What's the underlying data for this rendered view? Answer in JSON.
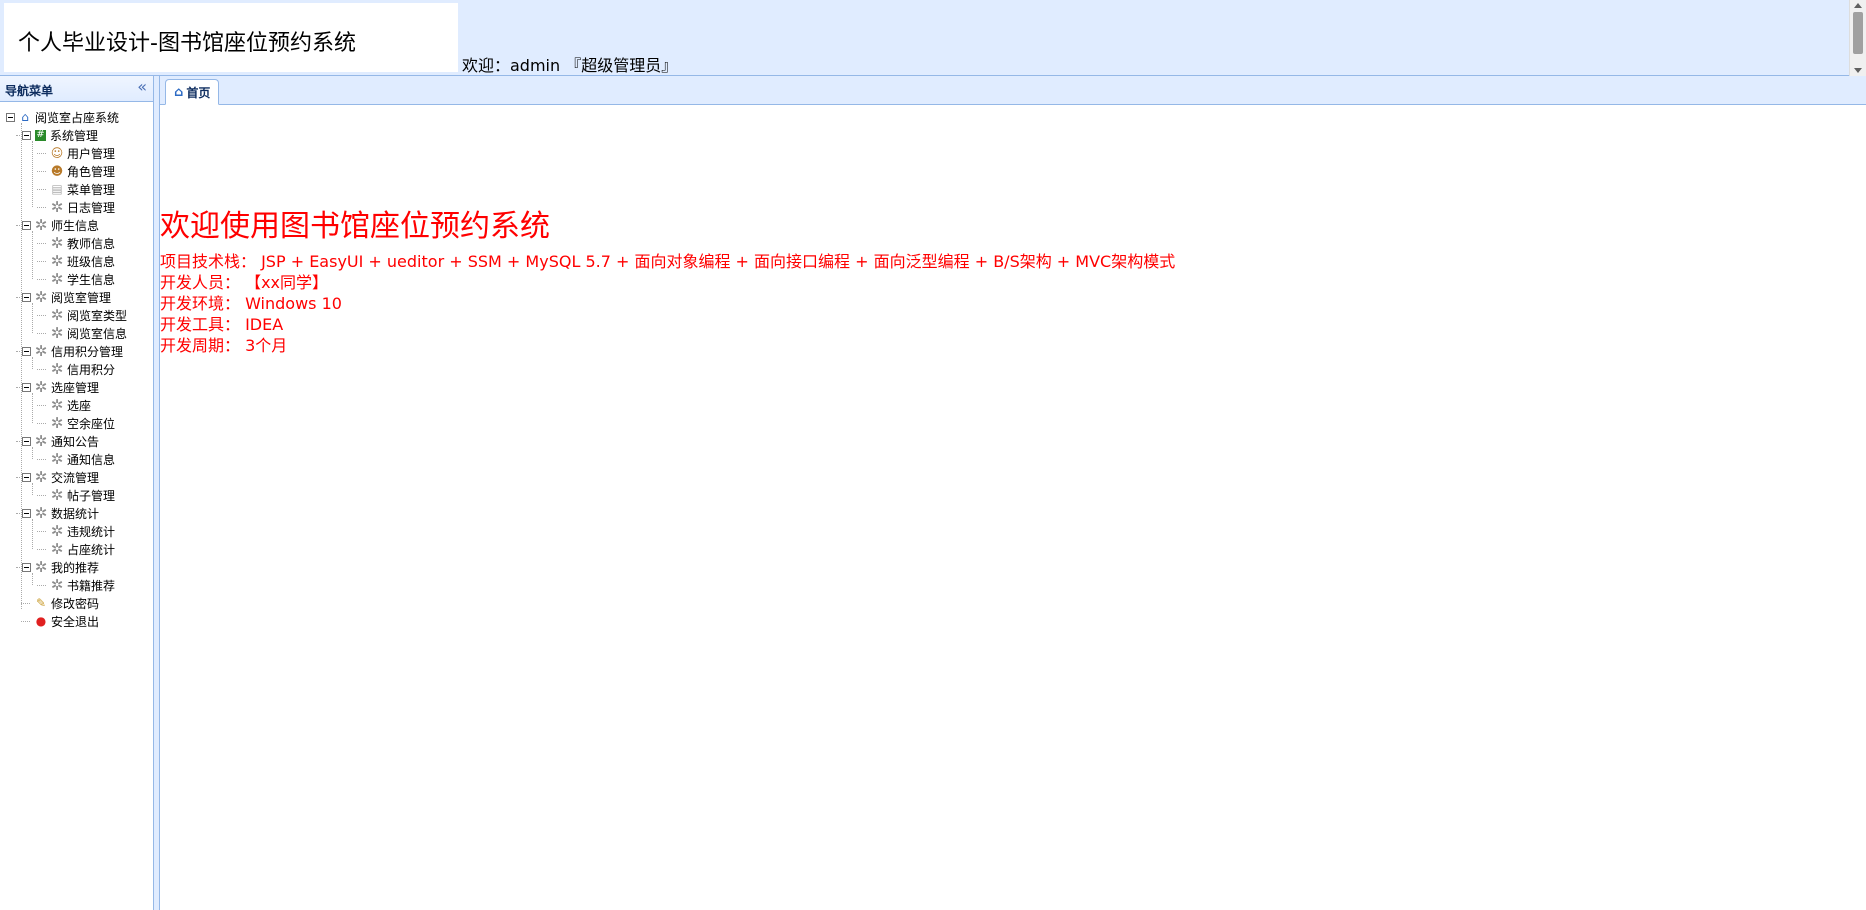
{
  "header": {
    "title": "个人毕业设计-图书馆座位预约系统",
    "welcome": "欢迎：admin 『超级管理员』"
  },
  "sidebar": {
    "title": "导航菜单",
    "collapse_icon": "double-chevron-left-icon",
    "root": {
      "label": "阅览室占座系统",
      "icon": "home-icon"
    },
    "groups": [
      {
        "label": "系统管理",
        "icon": "system-icon",
        "children": [
          {
            "label": "用户管理",
            "icon": "user-icon"
          },
          {
            "label": "角色管理",
            "icon": "role-icon"
          },
          {
            "label": "菜单管理",
            "icon": "menu-icon"
          },
          {
            "label": "日志管理",
            "icon": "gear-icon"
          }
        ]
      },
      {
        "label": "师生信息",
        "icon": "gear-icon",
        "children": [
          {
            "label": "教师信息",
            "icon": "gear-icon"
          },
          {
            "label": "班级信息",
            "icon": "gear-icon"
          },
          {
            "label": "学生信息",
            "icon": "gear-icon"
          }
        ]
      },
      {
        "label": "阅览室管理",
        "icon": "gear-icon",
        "children": [
          {
            "label": "阅览室类型",
            "icon": "gear-icon"
          },
          {
            "label": "阅览室信息",
            "icon": "gear-icon"
          }
        ]
      },
      {
        "label": "信用积分管理",
        "icon": "gear-icon",
        "children": [
          {
            "label": "信用积分",
            "icon": "gear-icon"
          }
        ]
      },
      {
        "label": "选座管理",
        "icon": "gear-icon",
        "children": [
          {
            "label": "选座",
            "icon": "gear-icon"
          },
          {
            "label": "空余座位",
            "icon": "gear-icon"
          }
        ]
      },
      {
        "label": "通知公告",
        "icon": "gear-icon",
        "children": [
          {
            "label": "通知信息",
            "icon": "gear-icon"
          }
        ]
      },
      {
        "label": "交流管理",
        "icon": "gear-icon",
        "children": [
          {
            "label": "帖子管理",
            "icon": "gear-icon"
          }
        ]
      },
      {
        "label": "数据统计",
        "icon": "gear-icon",
        "children": [
          {
            "label": "违规统计",
            "icon": "gear-icon"
          },
          {
            "label": "占座统计",
            "icon": "gear-icon"
          }
        ]
      },
      {
        "label": "我的推荐",
        "icon": "gear-icon",
        "children": [
          {
            "label": "书籍推荐",
            "icon": "gear-icon"
          }
        ]
      }
    ],
    "leaves": [
      {
        "label": "修改密码",
        "icon": "password-icon"
      },
      {
        "label": "安全退出",
        "icon": "exit-icon"
      }
    ]
  },
  "tabs": [
    {
      "label": "首页",
      "icon": "home-icon"
    }
  ],
  "content": {
    "heading": "欢迎使用图书馆座位预约系统",
    "lines": [
      "项目技术栈： JSP + EasyUI + ueditor + SSM + MySQL 5.7 + 面向对象编程 + 面向接口编程 + 面向泛型编程 + B/S架构 + MVC架构模式",
      "开发人员： 【xx同学】",
      "开发环境： Windows 10",
      "开发工具： IDEA",
      "开发周期： 3个月"
    ]
  },
  "colors": {
    "header_bg": "#E0ECFF",
    "border": "#95B8E7",
    "accent_text": "#ff0000"
  }
}
